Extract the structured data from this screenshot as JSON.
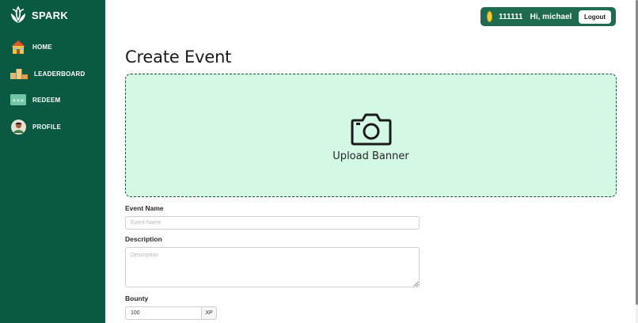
{
  "app": {
    "name": "SPARK"
  },
  "sidebar": {
    "items": [
      {
        "label": "HOME",
        "icon": "house-icon"
      },
      {
        "label": "LEADERBOARD",
        "icon": "podium-icon"
      },
      {
        "label": "REDEEM",
        "icon": "ticket-icon"
      },
      {
        "label": "PROFILE",
        "icon": "avatar-icon"
      }
    ]
  },
  "userbar": {
    "coins": "111111",
    "greeting": "Hi, michael",
    "logout_label": "Logout"
  },
  "page": {
    "title": "Create Event"
  },
  "upload": {
    "label": "Upload Banner"
  },
  "form": {
    "event_name": {
      "label": "Event Name",
      "placeholder": "Event Name",
      "value": ""
    },
    "description": {
      "label": "Description",
      "placeholder": "Description",
      "value": ""
    },
    "bounty": {
      "label": "Bounty",
      "value": "100",
      "unit": "XP"
    }
  },
  "colors": {
    "sidebar_bg": "#0a5a43",
    "upload_bg": "#d3f9e5",
    "coin": "#f2cd3a"
  }
}
